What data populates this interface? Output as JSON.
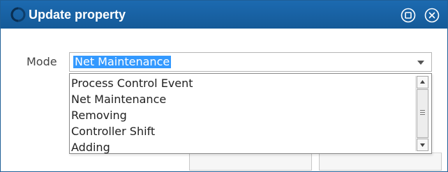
{
  "dialog": {
    "title": "Update property",
    "window_buttons": {
      "maximize_icon": "restore-circle-icon",
      "close_icon": "close-circle-icon"
    }
  },
  "form": {
    "mode_label": "Mode",
    "mode_select": {
      "selected_value": "Net Maintenance",
      "options": [
        "Process Control Event",
        "Net Maintenance",
        "Removing",
        "Controller Shift",
        "Adding"
      ]
    }
  },
  "colors": {
    "titlebar": "#1a64a8",
    "selection_highlight": "#3399ff",
    "label_text": "#444444"
  }
}
